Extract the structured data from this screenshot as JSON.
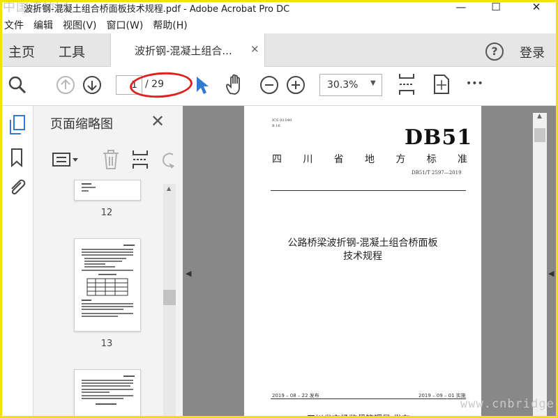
{
  "window": {
    "watermark_top": "中国道桥网",
    "title": "波折钢-混凝土组合桥面板技术规程.pdf - Adobe Acrobat Pro DC",
    "minimize": "—",
    "maximize": "☐",
    "close": "✕"
  },
  "menu": {
    "items": [
      {
        "label": "文件"
      },
      {
        "label": "编辑"
      },
      {
        "label": "视图(V)"
      },
      {
        "label": "窗口(W)"
      },
      {
        "label": "帮助(H)"
      }
    ]
  },
  "tabs": {
    "home": "主页",
    "tools": "工具",
    "document": "波折钢-混凝土组合...",
    "document_close": "×",
    "help": "?",
    "login": "登录"
  },
  "toolbar": {
    "current_page": "1",
    "total_pages": "/ 29",
    "zoom": "30.3%",
    "more": "•••"
  },
  "thumbnails": {
    "title": "页面缩略图",
    "close": "✕",
    "pages": [
      {
        "num": "12"
      },
      {
        "num": "13"
      }
    ]
  },
  "page": {
    "ics": "ICS 93.040",
    "b": "B 16",
    "db": "DB51",
    "province": [
      "四",
      "川",
      "省",
      "地",
      "方",
      "标",
      "准"
    ],
    "code": "DB51/T 2597—2019",
    "title_line1": "公路桥梁波折钢-混凝土组合桥面板",
    "title_line2": "技术规程",
    "issue_date": "2019 – 08 – 22 发布",
    "impl_date": "2019 – 09 – 01 实施",
    "issuer": "四川省市场监督管理局   发布"
  },
  "watermark_bottom": "www.cnbridge.com",
  "colors": {
    "frame": "#f3e200",
    "annotation_oval": "#e02020",
    "select_tool": "#2f7ad6",
    "doc_background": "#888888"
  }
}
